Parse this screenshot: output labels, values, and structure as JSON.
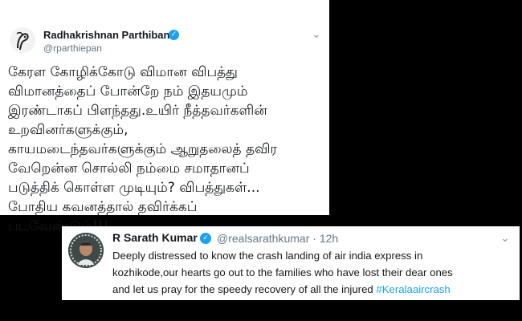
{
  "tweet1": {
    "author_name": "Radhakrishnan Parthiban",
    "handle": "@rparthiepan",
    "verified_icon": "verified-badge-icon",
    "menu_icon": "chevron-down-icon",
    "text_lines": [
      "கேரள கோழிக்கோடு விமான விபத்து",
      "விமானத்தைப் போன்றே நம் இதயமும்",
      "இரண்டாகப் பிளந்தது.உயிர் நீத்தவர்களின்",
      "உறவினர்களுக்கும்,",
      "காயமடைந்தவர்களுக்கும் ஆறுதலைத் தவிர",
      "வேறென்ன சொல்லி நம்மை சமாதானப்",
      "படுத்திக் கொள்ள முடியும்? விபத்துகள்...",
      "போதிய கவனத்தால் தவிர்க்கப்",
      "படவேண்டும்!!!"
    ]
  },
  "tweet2": {
    "author_name": "R Sarath Kumar",
    "handle": "@realsarathkumar",
    "separator": "·",
    "time": "12h",
    "verified_icon": "verified-badge-icon",
    "menu_icon": "chevron-down-icon",
    "text_line1": "Deeply distressed to know the crash landing of air india express in",
    "text_line2": "kozhikode,our hearts go out to the families who have lost their dear ones",
    "text_line3": "and let us pray for the speedy recovery of all the injured ",
    "hashtag": "#Keralaaircrash"
  },
  "colors": {
    "background": "#000000",
    "card": "#ffffff",
    "accent": "#1da1f2",
    "text": "#14171a",
    "muted": "#657786"
  }
}
